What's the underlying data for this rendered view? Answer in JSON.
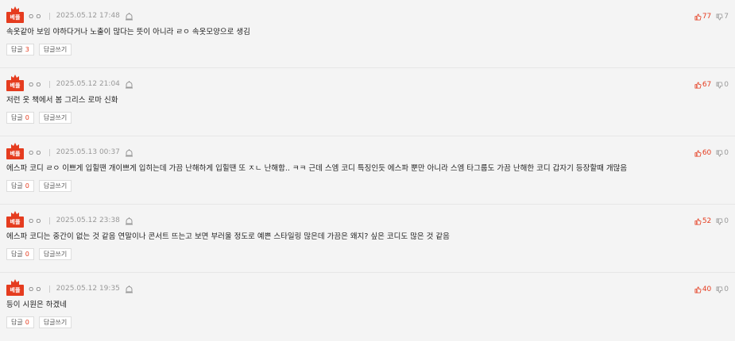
{
  "badge_label": "베플",
  "reply_label": "답글",
  "write_reply_label": "답글쓰기",
  "comments": [
    {
      "nick": "ㅇㅇ",
      "date": "2025.05.12 17:48",
      "text": "속옷같아 보임 야하다거나 노출이 많다는 뜻이 아니라 ㄹㅇ 속옷모양으로 생김",
      "replies": "3",
      "up": "77",
      "down": "7"
    },
    {
      "nick": "ㅇㅇ",
      "date": "2025.05.12 21:04",
      "text": "저런 옷 책에서 봄 그리스 로마 신화",
      "replies": "0",
      "up": "67",
      "down": "0"
    },
    {
      "nick": "ㅇㅇ",
      "date": "2025.05.13 00:37",
      "text": "에스파 코디 ㄹㅇ 이쁘게 입힐땐 개이쁘게 입히는데 가끔 난해하게 입힐땐 또 ㅈㄴ 난해함.. ㅋㅋ 근데 스엠 코디 특징인듯 에스파 뿐만 아니라 스엠 타그룹도 가끔 난해한 코디 갑자기 등장할때 개많음",
      "replies": "0",
      "up": "60",
      "down": "0"
    },
    {
      "nick": "ㅇㅇ",
      "date": "2025.05.12 23:38",
      "text": "에스파 코디는 중간이 없는 것 같음 연말이나 콘서트 뜨는고 보면 부러울 정도로 예쁜 스타일링 많은데 가끔은 왜지? 싶은 코디도 많은 것 같음",
      "replies": "0",
      "up": "52",
      "down": "0"
    },
    {
      "nick": "ㅇㅇ",
      "date": "2025.05.12 19:35",
      "text": "등이 시원은 하겠네",
      "replies": "0",
      "up": "40",
      "down": "0"
    }
  ]
}
